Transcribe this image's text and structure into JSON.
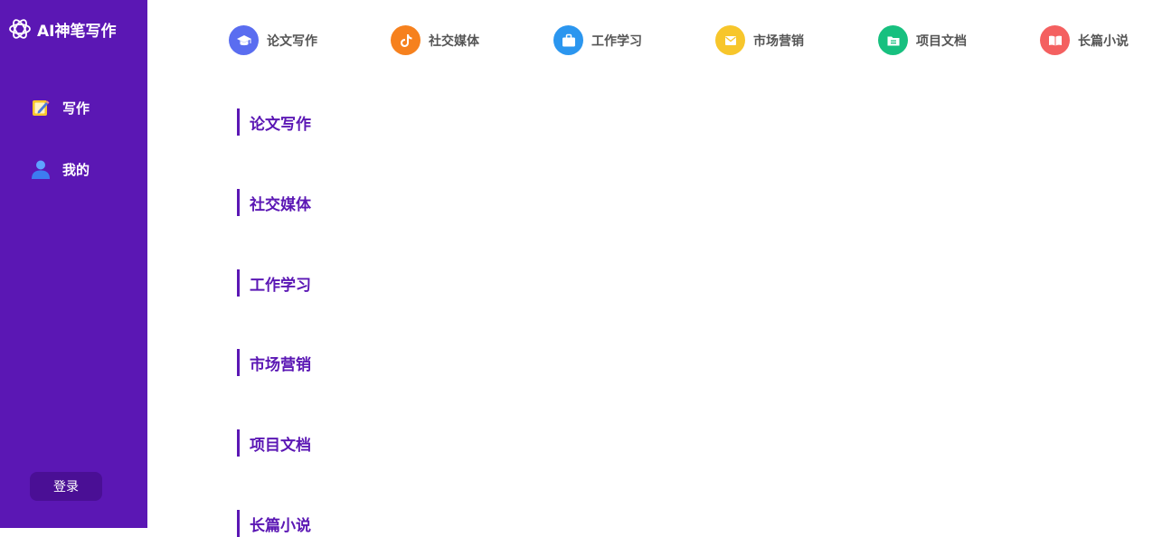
{
  "app": {
    "title": "AI神笔写作",
    "logo_icon": "openai-knot-icon"
  },
  "sidebar": {
    "items": [
      {
        "label": "写作",
        "icon": "edit-note-icon"
      },
      {
        "label": "我的",
        "icon": "user-icon"
      }
    ],
    "login_label": "登录"
  },
  "categories": [
    {
      "label": "论文写作",
      "icon": "graduation-cap-icon",
      "color": "#5a6df0"
    },
    {
      "label": "社交媒体",
      "icon": "tiktok-icon",
      "color": "#f6811e"
    },
    {
      "label": "工作学习",
      "icon": "briefcase-icon",
      "color": "#2b96ef"
    },
    {
      "label": "市场营销",
      "icon": "mail-icon",
      "color": "#f7c62b"
    },
    {
      "label": "项目文档",
      "icon": "folder-icon",
      "color": "#17c07f"
    },
    {
      "label": "长篇小说",
      "icon": "book-icon",
      "color": "#f46060"
    }
  ],
  "sections": [
    {
      "title": "论文写作"
    },
    {
      "title": "社交媒体"
    },
    {
      "title": "工作学习"
    },
    {
      "title": "市场营销"
    },
    {
      "title": "项目文档"
    },
    {
      "title": "长篇小说"
    }
  ],
  "colors": {
    "sidebar_bg": "#5b17b4",
    "accent": "#5b17b4",
    "login_bg": "#4a0f95"
  }
}
